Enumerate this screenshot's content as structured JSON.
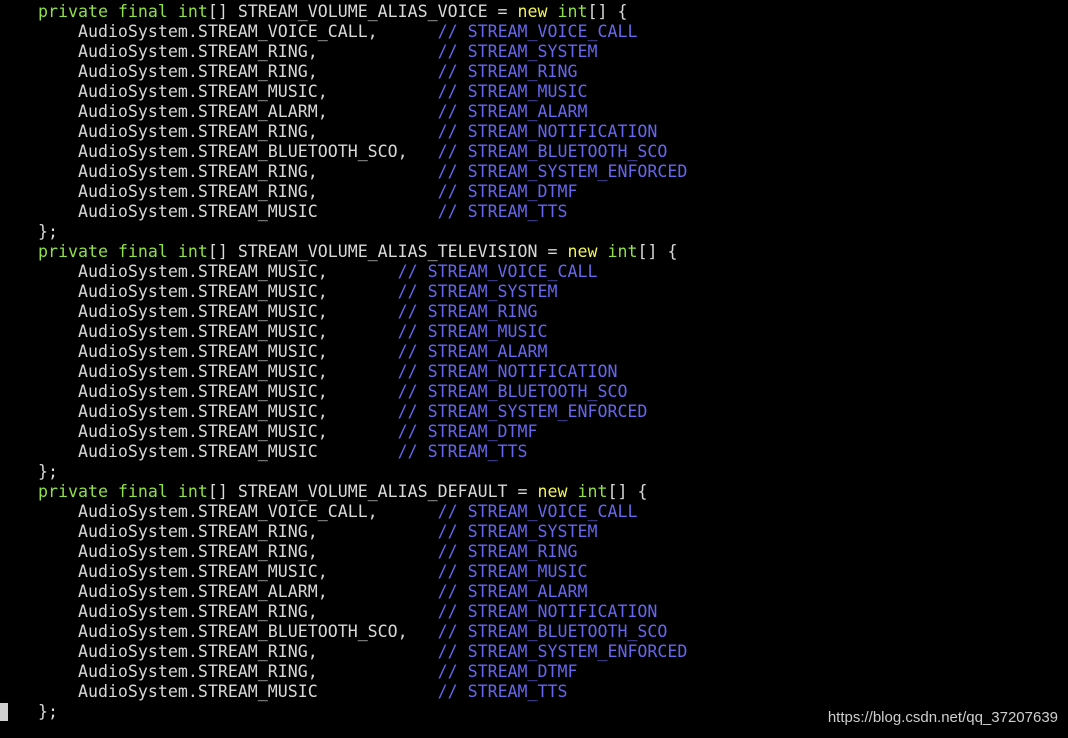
{
  "terminal": {
    "lines": [
      [
        {
          "t": "private final int",
          "c": "kw"
        },
        {
          "t": "[] STREAM_VOLUME_ALIAS_VOICE = ",
          "c": "plain"
        },
        {
          "t": "new",
          "c": "new"
        },
        {
          "t": " ",
          "c": "plain"
        },
        {
          "t": "int",
          "c": "kw"
        },
        {
          "t": "[] {",
          "c": "plain"
        }
      ],
      [
        {
          "t": "    AudioSystem.STREAM_VOICE_CALL,      ",
          "c": "plain"
        },
        {
          "t": "// STREAM_VOICE_CALL",
          "c": "cmt"
        }
      ],
      [
        {
          "t": "    AudioSystem.STREAM_RING,            ",
          "c": "plain"
        },
        {
          "t": "// STREAM_SYSTEM",
          "c": "cmt"
        }
      ],
      [
        {
          "t": "    AudioSystem.STREAM_RING,            ",
          "c": "plain"
        },
        {
          "t": "// STREAM_RING",
          "c": "cmt"
        }
      ],
      [
        {
          "t": "    AudioSystem.STREAM_MUSIC,           ",
          "c": "plain"
        },
        {
          "t": "// STREAM_MUSIC",
          "c": "cmt"
        }
      ],
      [
        {
          "t": "    AudioSystem.STREAM_ALARM,           ",
          "c": "plain"
        },
        {
          "t": "// STREAM_ALARM",
          "c": "cmt"
        }
      ],
      [
        {
          "t": "    AudioSystem.STREAM_RING,            ",
          "c": "plain"
        },
        {
          "t": "// STREAM_NOTIFICATION",
          "c": "cmt"
        }
      ],
      [
        {
          "t": "    AudioSystem.STREAM_BLUETOOTH_SCO,   ",
          "c": "plain"
        },
        {
          "t": "// STREAM_BLUETOOTH_SCO",
          "c": "cmt"
        }
      ],
      [
        {
          "t": "    AudioSystem.STREAM_RING,            ",
          "c": "plain"
        },
        {
          "t": "// STREAM_SYSTEM_ENFORCED",
          "c": "cmt"
        }
      ],
      [
        {
          "t": "    AudioSystem.STREAM_RING,            ",
          "c": "plain"
        },
        {
          "t": "// STREAM_DTMF",
          "c": "cmt"
        }
      ],
      [
        {
          "t": "    AudioSystem.STREAM_MUSIC            ",
          "c": "plain"
        },
        {
          "t": "// STREAM_TTS",
          "c": "cmt"
        }
      ],
      [
        {
          "t": "};",
          "c": "plain"
        }
      ],
      [
        {
          "t": "private final int",
          "c": "kw"
        },
        {
          "t": "[] STREAM_VOLUME_ALIAS_TELEVISION = ",
          "c": "plain"
        },
        {
          "t": "new",
          "c": "new"
        },
        {
          "t": " ",
          "c": "plain"
        },
        {
          "t": "int",
          "c": "kw"
        },
        {
          "t": "[] {",
          "c": "plain"
        }
      ],
      [
        {
          "t": "    AudioSystem.STREAM_MUSIC,       ",
          "c": "plain"
        },
        {
          "t": "// STREAM_VOICE_CALL",
          "c": "cmt"
        }
      ],
      [
        {
          "t": "    AudioSystem.STREAM_MUSIC,       ",
          "c": "plain"
        },
        {
          "t": "// STREAM_SYSTEM",
          "c": "cmt"
        }
      ],
      [
        {
          "t": "    AudioSystem.STREAM_MUSIC,       ",
          "c": "plain"
        },
        {
          "t": "// STREAM_RING",
          "c": "cmt"
        }
      ],
      [
        {
          "t": "    AudioSystem.STREAM_MUSIC,       ",
          "c": "plain"
        },
        {
          "t": "// STREAM_MUSIC",
          "c": "cmt"
        }
      ],
      [
        {
          "t": "    AudioSystem.STREAM_MUSIC,       ",
          "c": "plain"
        },
        {
          "t": "// STREAM_ALARM",
          "c": "cmt"
        }
      ],
      [
        {
          "t": "    AudioSystem.STREAM_MUSIC,       ",
          "c": "plain"
        },
        {
          "t": "// STREAM_NOTIFICATION",
          "c": "cmt"
        }
      ],
      [
        {
          "t": "    AudioSystem.STREAM_MUSIC,       ",
          "c": "plain"
        },
        {
          "t": "// STREAM_BLUETOOTH_SCO",
          "c": "cmt"
        }
      ],
      [
        {
          "t": "    AudioSystem.STREAM_MUSIC,       ",
          "c": "plain"
        },
        {
          "t": "// STREAM_SYSTEM_ENFORCED",
          "c": "cmt"
        }
      ],
      [
        {
          "t": "    AudioSystem.STREAM_MUSIC,       ",
          "c": "plain"
        },
        {
          "t": "// STREAM_DTMF",
          "c": "cmt"
        }
      ],
      [
        {
          "t": "    AudioSystem.STREAM_MUSIC        ",
          "c": "plain"
        },
        {
          "t": "// STREAM_TTS",
          "c": "cmt"
        }
      ],
      [
        {
          "t": "};",
          "c": "plain"
        }
      ],
      [
        {
          "t": "private final int",
          "c": "kw"
        },
        {
          "t": "[] STREAM_VOLUME_ALIAS_DEFAULT = ",
          "c": "plain"
        },
        {
          "t": "new",
          "c": "new"
        },
        {
          "t": " ",
          "c": "plain"
        },
        {
          "t": "int",
          "c": "kw"
        },
        {
          "t": "[] {",
          "c": "plain"
        }
      ],
      [
        {
          "t": "    AudioSystem.STREAM_VOICE_CALL,      ",
          "c": "plain"
        },
        {
          "t": "// STREAM_VOICE_CALL",
          "c": "cmt"
        }
      ],
      [
        {
          "t": "    AudioSystem.STREAM_RING,            ",
          "c": "plain"
        },
        {
          "t": "// STREAM_SYSTEM",
          "c": "cmt"
        }
      ],
      [
        {
          "t": "    AudioSystem.STREAM_RING,            ",
          "c": "plain"
        },
        {
          "t": "// STREAM_RING",
          "c": "cmt"
        }
      ],
      [
        {
          "t": "    AudioSystem.STREAM_MUSIC,           ",
          "c": "plain"
        },
        {
          "t": "// STREAM_MUSIC",
          "c": "cmt"
        }
      ],
      [
        {
          "t": "    AudioSystem.STREAM_ALARM,           ",
          "c": "plain"
        },
        {
          "t": "// STREAM_ALARM",
          "c": "cmt"
        }
      ],
      [
        {
          "t": "    AudioSystem.STREAM_RING,            ",
          "c": "plain"
        },
        {
          "t": "// STREAM_NOTIFICATION",
          "c": "cmt"
        }
      ],
      [
        {
          "t": "    AudioSystem.STREAM_BLUETOOTH_SCO,   ",
          "c": "plain"
        },
        {
          "t": "// STREAM_BLUETOOTH_SCO",
          "c": "cmt"
        }
      ],
      [
        {
          "t": "    AudioSystem.STREAM_RING,            ",
          "c": "plain"
        },
        {
          "t": "// STREAM_SYSTEM_ENFORCED",
          "c": "cmt"
        }
      ],
      [
        {
          "t": "    AudioSystem.STREAM_RING,            ",
          "c": "plain"
        },
        {
          "t": "// STREAM_DTMF",
          "c": "cmt"
        }
      ],
      [
        {
          "t": "    AudioSystem.STREAM_MUSIC            ",
          "c": "plain"
        },
        {
          "t": "// STREAM_TTS",
          "c": "cmt"
        }
      ],
      [
        {
          "t": "};",
          "c": "plain"
        }
      ]
    ]
  },
  "watermark": {
    "text": "https://blog.csdn.net/qq_37207639"
  },
  "colors": {
    "background": "#000000",
    "keyword": "#8fe04a",
    "new_keyword": "#f3f35a",
    "plain": "#d8d8d8",
    "comment": "#6666ee"
  }
}
